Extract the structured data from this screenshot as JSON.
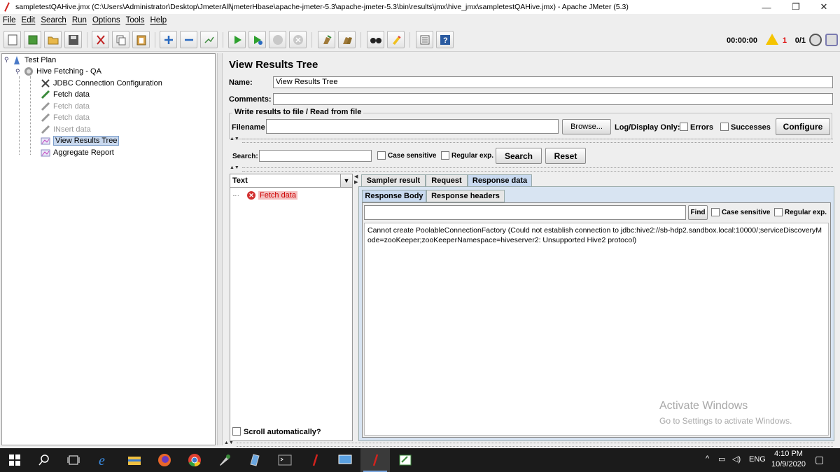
{
  "window": {
    "title": "sampletestQAHive.jmx (C:\\Users\\Administrator\\Desktop\\JmeterAll\\jmeterHbase\\apache-jmeter-5.3\\apache-jmeter-5.3\\bin\\results\\jmx\\hive_jmx\\sampletestQAHive.jmx) - Apache JMeter (5.3)",
    "minimize": "—",
    "restore": "❐",
    "close": "✕"
  },
  "menu": [
    "File",
    "Edit",
    "Search",
    "Run",
    "Options",
    "Tools",
    "Help"
  ],
  "toolbar": {
    "icons": [
      "new-icon",
      "templates-icon",
      "open-icon",
      "save-icon",
      "cut-icon",
      "copy-icon",
      "paste-icon",
      "expand-icon",
      "collapse-icon",
      "toggle-icon",
      "start-icon",
      "start-no-pause-icon",
      "stop-icon",
      "shutdown-icon",
      "clear-icon",
      "clear-all-icon",
      "search-icon",
      "reset-search-icon",
      "function-helper-icon",
      "help-icon"
    ],
    "timer": "00:00:00",
    "warning_count": "1",
    "threads": "0/1"
  },
  "tree": {
    "nodes": [
      {
        "label": "Test Plan",
        "icon": "test-plan-icon"
      },
      {
        "label": "Hive Fetching - QA",
        "icon": "thread-group-icon"
      },
      {
        "label": "JDBC Connection Configuration",
        "icon": "config-icon"
      },
      {
        "label": "Fetch data",
        "icon": "sampler-icon"
      },
      {
        "label": "Fetch data",
        "icon": "sampler-icon"
      },
      {
        "label": "Fetch data",
        "icon": "sampler-icon"
      },
      {
        "label": "INsert data",
        "icon": "sampler-icon"
      },
      {
        "label": "View Results Tree",
        "icon": "listener-icon"
      },
      {
        "label": "Aggregate Report",
        "icon": "listener-icon"
      }
    ]
  },
  "panel": {
    "title": "View Results Tree",
    "name_label": "Name:",
    "name_value": "View Results Tree",
    "comments_label": "Comments:",
    "comments_value": "",
    "file_group_label": "Write results to file / Read from file",
    "filename_label": "Filename",
    "filename_value": "",
    "browse_label": "Browse...",
    "log_display_label": "Log/Display Only:",
    "errors_label": "Errors",
    "successes_label": "Successes",
    "configure_label": "Configure",
    "search_label": "Search:",
    "search_value": "",
    "case_sensitive_label": "Case sensitive",
    "regex_label": "Regular exp.",
    "search_button": "Search",
    "reset_button": "Reset"
  },
  "results": {
    "renderer": "Text",
    "items": [
      {
        "label": "Fetch data",
        "status": "error"
      }
    ],
    "scroll_auto_label": "Scroll automatically?",
    "tabs": [
      "Sampler result",
      "Request",
      "Response data"
    ],
    "active_tab": "Response data",
    "sub_tabs": [
      "Response Body",
      "Response headers"
    ],
    "find_button": "Find",
    "find_case_label": "Case sensitive",
    "find_regex_label": "Regular exp.",
    "response_text": "Cannot create PoolableConnectionFactory (Could not establish connection to jdbc:hive2://sb-hdp2.sandbox.local:10000/;serviceDiscoveryMode=zooKeeper;zooKeeperNamespace=hiveserver2: Unsupported Hive2 protocol)"
  },
  "watermark": {
    "line1": "Activate Windows",
    "line2": "Go to Settings to activate Windows."
  },
  "taskbar": {
    "apps": [
      "windows-start-icon",
      "search-icon",
      "task-view-icon",
      "edge-icon",
      "file-explorer-icon",
      "firefox-icon",
      "chrome-icon",
      "tool-icon",
      "notepad-icon",
      "terminal-icon",
      "jmeter-icon",
      "remote-desktop-icon",
      "jmeter-icon",
      "editor-icon"
    ],
    "language": "ENG",
    "time": "4:10 PM",
    "date": "10/9/2020"
  },
  "colors": {
    "selected_node": "#c8d8ee",
    "error_red": "#d23030",
    "active_tab": "#c9daf0"
  }
}
